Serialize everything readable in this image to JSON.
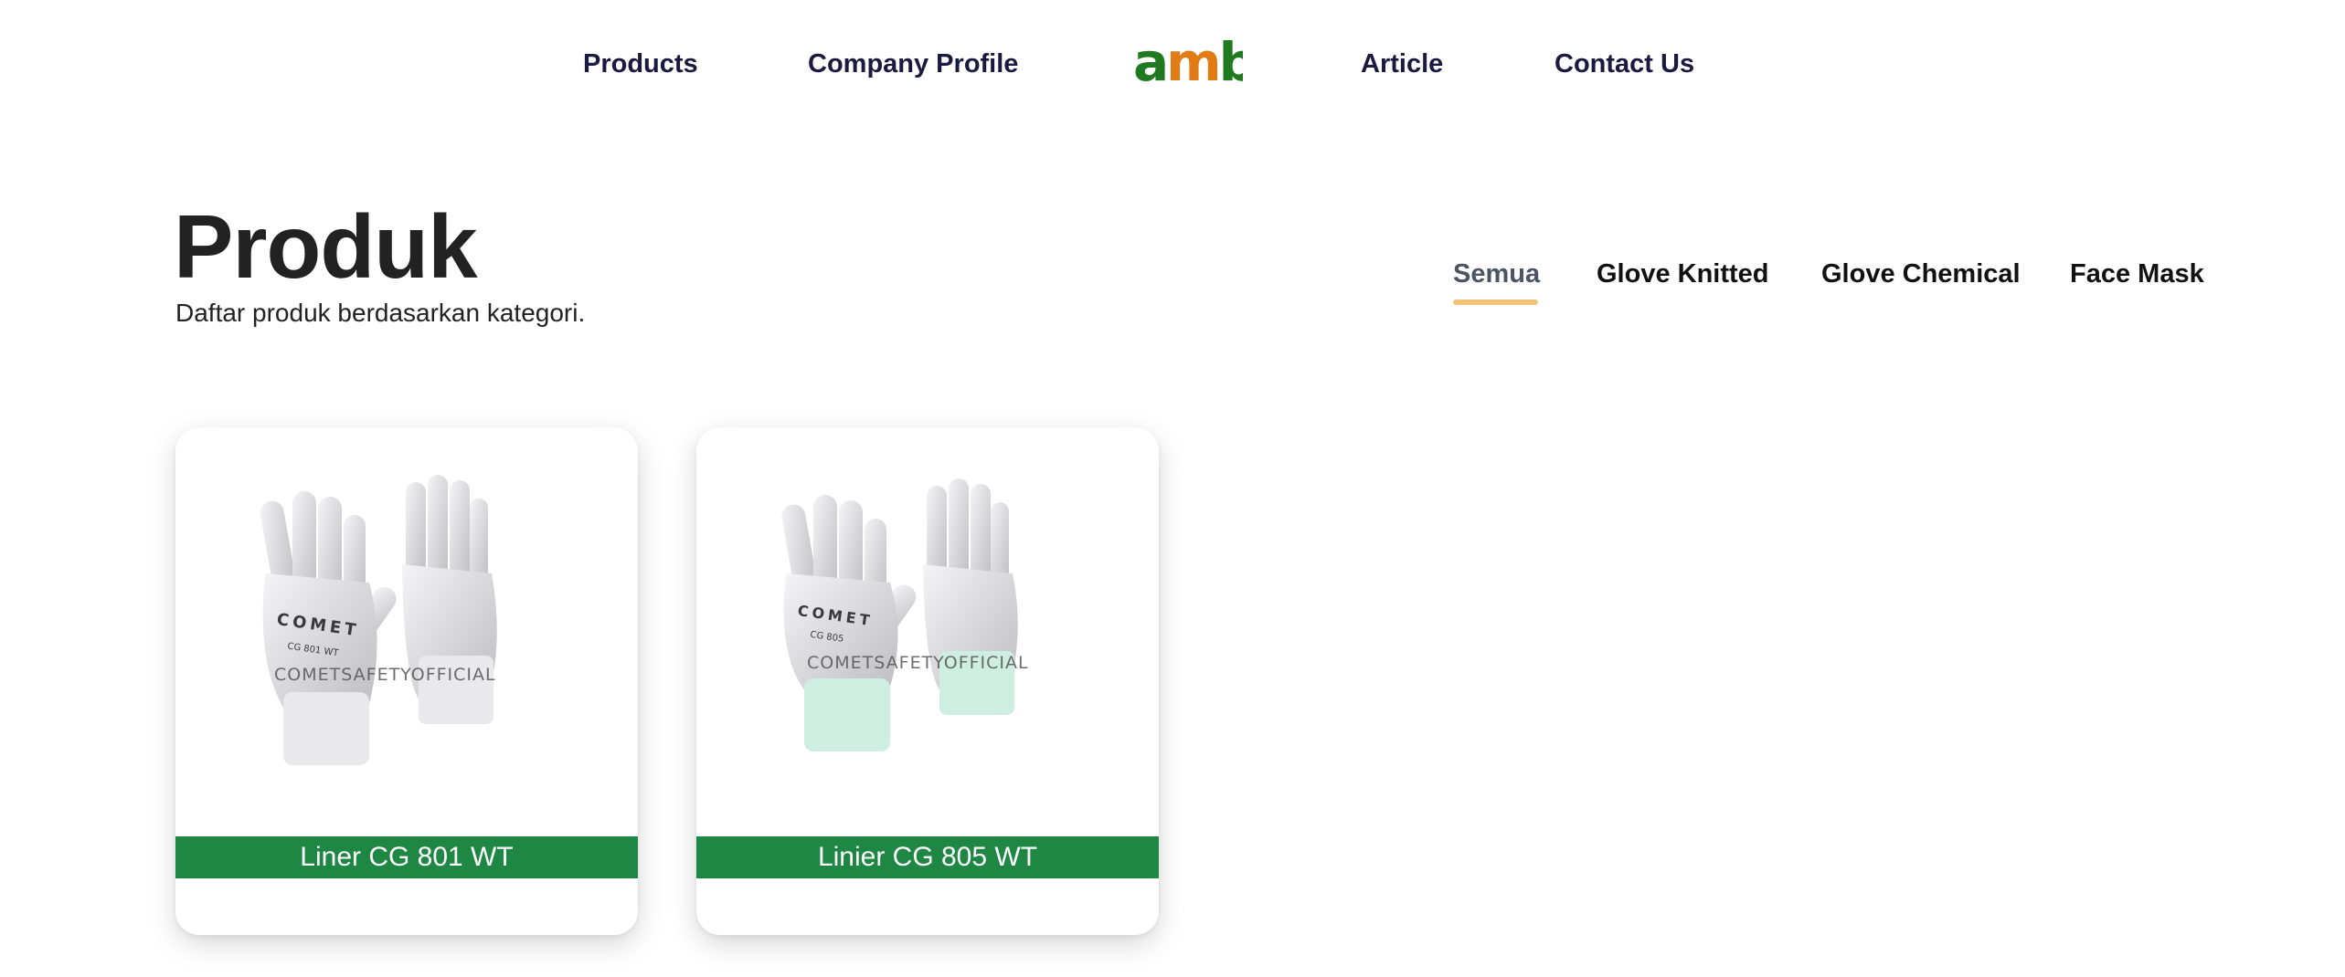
{
  "nav": {
    "left_items": [
      {
        "label": "Products"
      },
      {
        "label": "Company Profile"
      }
    ],
    "right_items": [
      {
        "label": "Article"
      },
      {
        "label": "Contact Us"
      }
    ],
    "logo": {
      "text": "amb",
      "colors": {
        "a": "#1f7a1f",
        "m": "#e07b16",
        "b": "#1f7a1f"
      }
    }
  },
  "hero": {
    "title": "Produk",
    "subtitle": "Daftar produk berdasarkan kategori."
  },
  "tabs": {
    "items": [
      {
        "label": "Semua",
        "active": true
      },
      {
        "label": "Glove Knitted",
        "active": false
      },
      {
        "label": "Glove Chemical",
        "active": false
      },
      {
        "label": "Face Mask",
        "active": false
      }
    ],
    "accent_color": "#f5c279"
  },
  "products": [
    {
      "name": "Liner CG 801 WT",
      "watermark": "COMETSAFETYOFFICIAL",
      "cuff_color": "#e9e9ec",
      "label_bg": "#1e8743"
    },
    {
      "name": "Linier CG 805 WT",
      "watermark": "COMETSAFETYOFFICIAL",
      "cuff_color": "#cdeee0",
      "label_bg": "#1e8743"
    }
  ]
}
